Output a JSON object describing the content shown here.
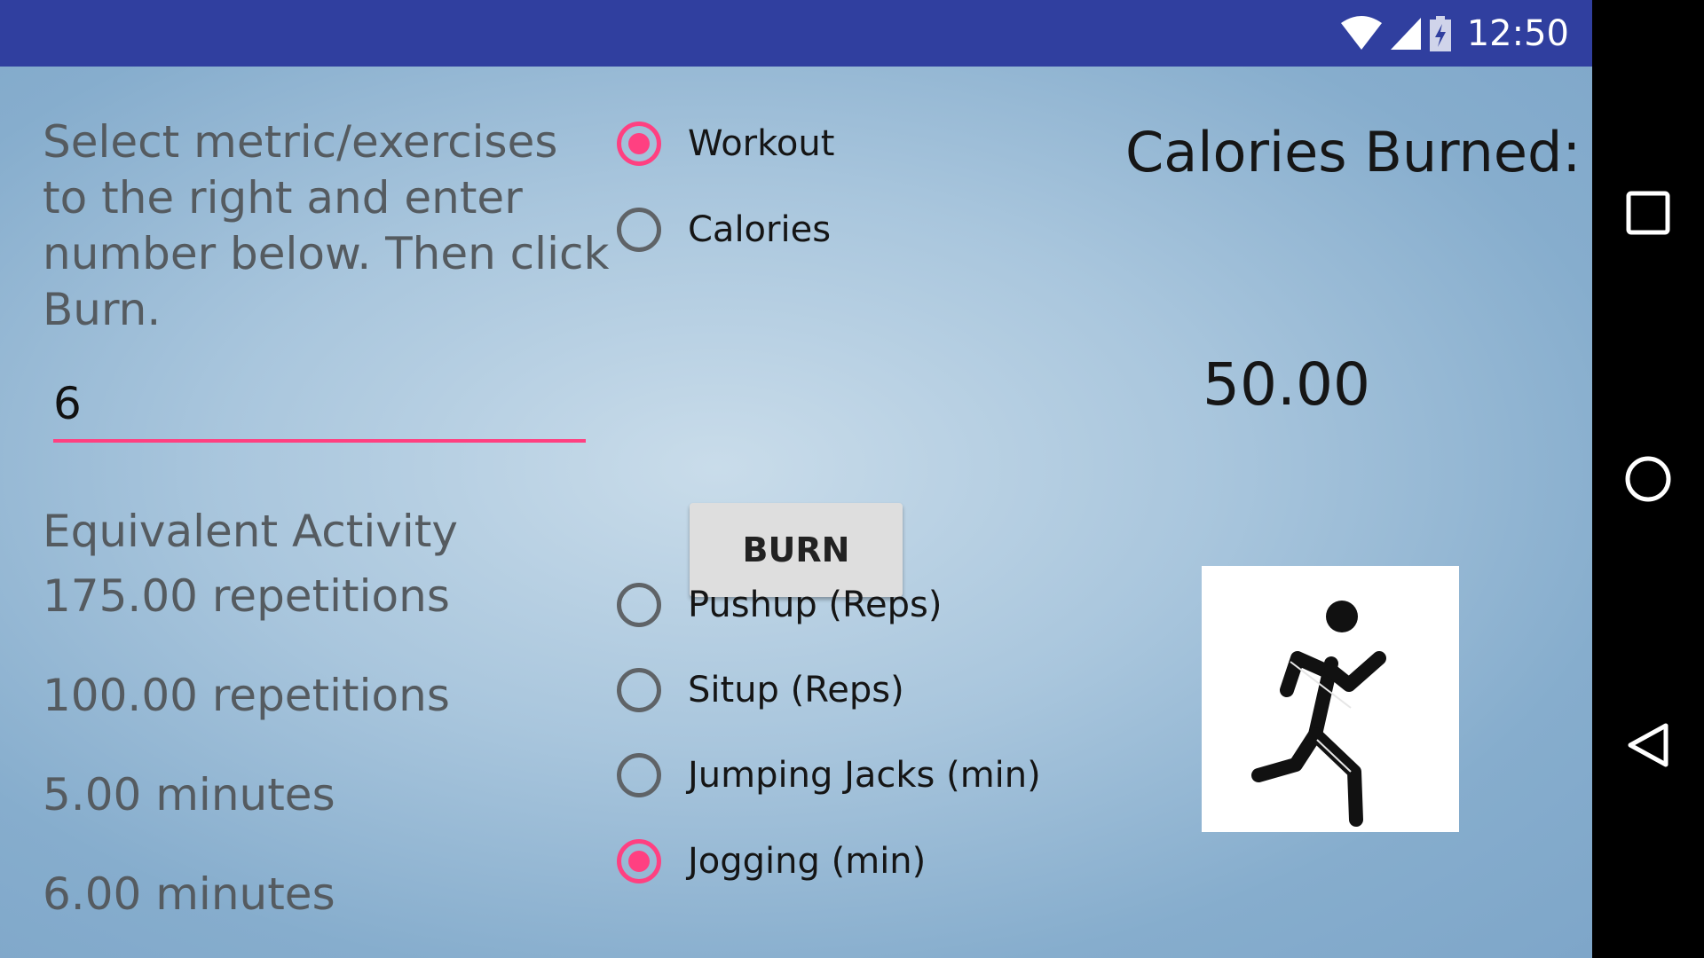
{
  "status_bar": {
    "time": "12:50",
    "icons": [
      "wifi-icon",
      "signal-icon",
      "battery-charging-icon"
    ]
  },
  "main": {
    "instructions": "Select metric/exercises to the right and enter number below. Then click Burn.",
    "number_input": {
      "value": "6",
      "placeholder": ""
    },
    "equivalent_title": "Equivalent Activity",
    "equivalent_values": [
      "175.00 repetitions",
      "100.00 repetitions",
      "5.00 minutes",
      "6.00 minutes"
    ],
    "metric_options": [
      {
        "label": "Workout",
        "checked": true
      },
      {
        "label": "Calories",
        "checked": false
      }
    ],
    "burn_label": "BURN",
    "exercise_options": [
      {
        "label": "Pushup (Reps)",
        "checked": false
      },
      {
        "label": "Situp (Reps)",
        "checked": false
      },
      {
        "label": "Jumping Jacks (min)",
        "checked": false
      },
      {
        "label": "Jogging (min)",
        "checked": true
      }
    ],
    "calories_title": "Calories Burned:",
    "calories_value": "50.00",
    "activity_icon": "running-person-icon"
  },
  "nav_bar": {
    "icons": [
      "recent-apps-icon",
      "home-icon",
      "back-icon"
    ]
  },
  "colors": {
    "status_bar": "#303f9f",
    "accent": "#ff4081",
    "text_secondary": "#555b60"
  }
}
